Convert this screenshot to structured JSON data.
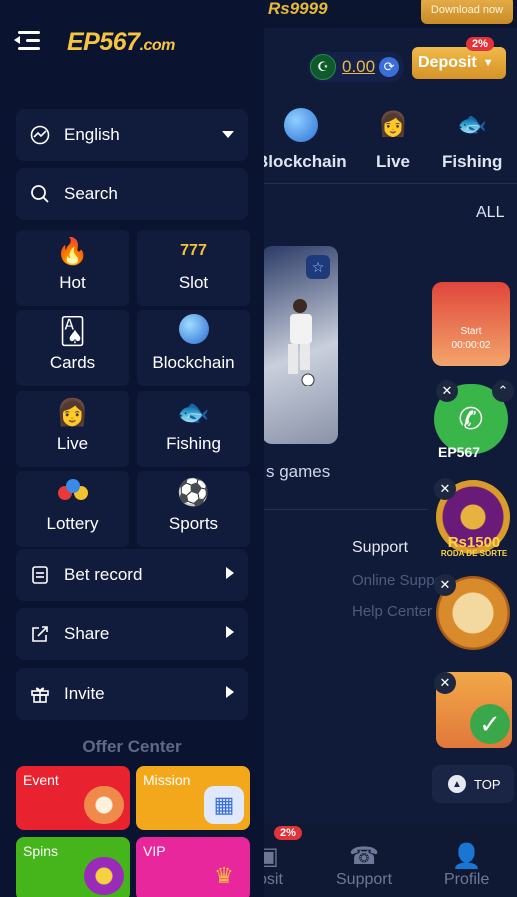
{
  "background": {
    "promo_text": "Rs9999",
    "download_label": "Download now",
    "balance": "0.00",
    "deposit_label": "Deposit",
    "deposit_badge": "2%",
    "categories": [
      "Blockchain",
      "Live",
      "Fishing"
    ],
    "all_label": "ALL",
    "games_label": "s games",
    "support_title": "Support",
    "support_links": [
      "Online Support",
      "Help Center"
    ],
    "top_label": "TOP",
    "floats": {
      "start_timer": "Start",
      "timer": "00:00:02",
      "ep_label": "EP567",
      "wheel_amount": "Rs1500",
      "wheel_sub": "RODA DE SORTE"
    },
    "bottom_nav": [
      {
        "label": "osit",
        "badge": "2%"
      },
      {
        "label": "Support"
      },
      {
        "label": "Profile"
      }
    ]
  },
  "drawer": {
    "logo": "EP567",
    "logo_suffix": ".com",
    "language": "English",
    "search_label": "Search",
    "categories": [
      {
        "label": "Hot",
        "icon": "fire-icon"
      },
      {
        "label": "Slot",
        "icon": "slot-777-icon"
      },
      {
        "label": "Cards",
        "icon": "cards-icon"
      },
      {
        "label": "Blockchain",
        "icon": "planet-icon"
      },
      {
        "label": "Live",
        "icon": "live-dealer-icon"
      },
      {
        "label": "Fishing",
        "icon": "fishing-icon"
      },
      {
        "label": "Lottery",
        "icon": "lottery-balls-icon"
      },
      {
        "label": "Sports",
        "icon": "soccer-ball-icon"
      }
    ],
    "menu": {
      "bet_record": "Bet record",
      "share": "Share",
      "invite": "Invite"
    },
    "offer_center_title": "Offer Center",
    "offers": [
      {
        "label": "Event",
        "color": "#e8232f"
      },
      {
        "label": "Mission",
        "color": "#f3a81c"
      },
      {
        "label": "Spins",
        "color": "#45b51b"
      },
      {
        "label": "VIP",
        "color": "#e9279c"
      }
    ]
  }
}
